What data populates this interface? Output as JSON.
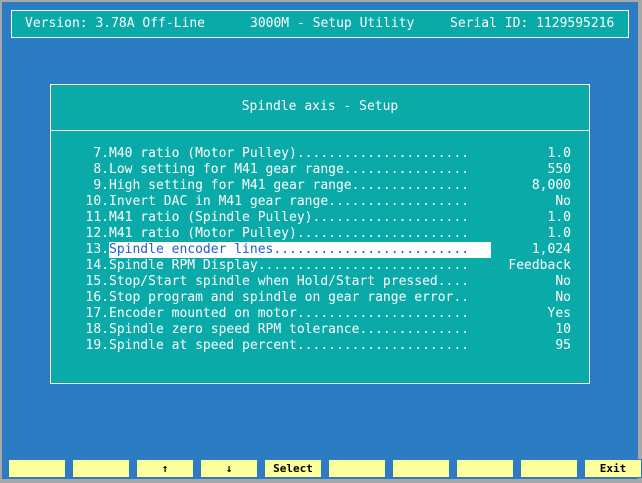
{
  "header": {
    "version": "Version: 3.78A Off-Line",
    "title": "3000M - Setup Utility",
    "serial": "Serial ID: 1129595216"
  },
  "dialog": {
    "title": "Spindle axis - Setup",
    "selected_index": 6,
    "rows": [
      {
        "num": "7.",
        "label": "M40 ratio (Motor Pulley)......................",
        "value": "1.0"
      },
      {
        "num": "8.",
        "label": "Low setting for M41 gear range................",
        "value": "550"
      },
      {
        "num": "9.",
        "label": "High setting for M41 gear range...............",
        "value": "8,000"
      },
      {
        "num": "10.",
        "label": "Invert DAC in M41 gear range..................",
        "value": "No"
      },
      {
        "num": "11.",
        "label": "M41 ratio (Spindle Pulley)....................",
        "value": "1.0"
      },
      {
        "num": "12.",
        "label": "M41 ratio (Motor Pulley)......................",
        "value": "1.0"
      },
      {
        "num": "13.",
        "label": "Spindle encoder lines.........................",
        "value": "1,024"
      },
      {
        "num": "14.",
        "label": "Spindle RPM Display...........................",
        "value": "Feedback"
      },
      {
        "num": "15.",
        "label": "Stop/Start spindle when Hold/Start pressed....",
        "value": "No"
      },
      {
        "num": "16.",
        "label": "Stop program and spindle on gear range error..",
        "value": "No"
      },
      {
        "num": "17.",
        "label": "Encoder mounted on motor......................",
        "value": "Yes"
      },
      {
        "num": "18.",
        "label": "Spindle zero speed RPM tolerance..............",
        "value": "10"
      },
      {
        "num": "19.",
        "label": "Spindle at speed percent......................",
        "value": "95"
      }
    ]
  },
  "fkeys": [
    {
      "label": "",
      "name": "f1-key"
    },
    {
      "label": "",
      "name": "f2-key"
    },
    {
      "label": "↑",
      "name": "up-arrow-key"
    },
    {
      "label": "↓",
      "name": "down-arrow-key"
    },
    {
      "label": "Select",
      "name": "select-key"
    },
    {
      "label": "",
      "name": "f6-key"
    },
    {
      "label": "",
      "name": "f7-key"
    },
    {
      "label": "",
      "name": "f8-key"
    },
    {
      "label": "",
      "name": "f9-key"
    },
    {
      "label": "Exit",
      "name": "exit-key"
    }
  ]
}
